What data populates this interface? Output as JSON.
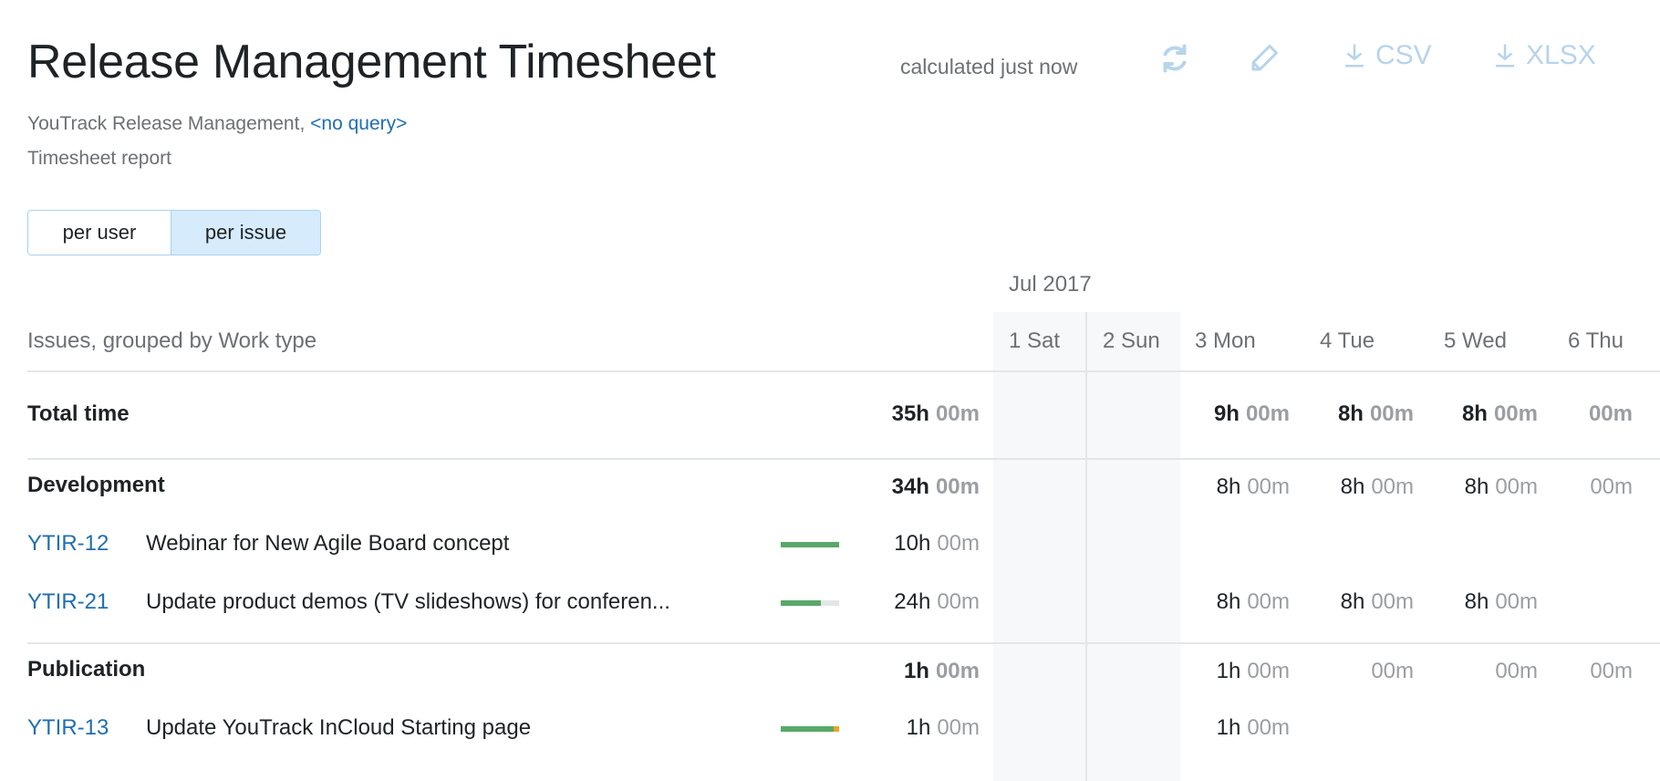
{
  "header": {
    "title": "Release Management Timesheet",
    "calculated": "calculated just now",
    "refresh_icon": "refresh-icon",
    "edit_icon": "pencil-icon",
    "csv_label": "CSV",
    "xlsx_label": "XLSX",
    "download_icon": "download-icon"
  },
  "subtitle": {
    "project": "YouTrack Release Management,",
    "query": "<no query>",
    "report_type": "Timesheet report"
  },
  "toggle": {
    "options": [
      "per user",
      "per issue"
    ],
    "selected": "per issue"
  },
  "table": {
    "grouping_label": "Issues, grouped by Work type",
    "month": "Jul 2017",
    "days": [
      "1 Sat",
      "2 Sun",
      "3 Mon",
      "4 Tue",
      "5 Wed",
      "6 Thu"
    ],
    "weekend_days": [
      "1 Sat",
      "2 Sun"
    ],
    "total": {
      "label": "Total time",
      "sum": {
        "h": "35h",
        "m": "00m"
      },
      "days": [
        null,
        null,
        {
          "h": "9h",
          "m": "00m"
        },
        {
          "h": "8h",
          "m": "00m"
        },
        {
          "h": "8h",
          "m": "00m"
        },
        {
          "h": "",
          "m": "00m"
        }
      ]
    },
    "groups": [
      {
        "name": "Development",
        "sum": {
          "h": "34h",
          "m": "00m"
        },
        "days": [
          null,
          null,
          {
            "h": "8h",
            "m": "00m"
          },
          {
            "h": "8h",
            "m": "00m"
          },
          {
            "h": "8h",
            "m": "00m"
          },
          {
            "h": "",
            "m": "00m"
          }
        ],
        "issues": [
          {
            "id": "YTIR-12",
            "summary": "Webinar for New Agile Board concept",
            "progress_spent": 1.0,
            "progress_over": 0,
            "sum": {
              "h": "10h",
              "m": "00m"
            },
            "days": [
              null,
              null,
              null,
              null,
              null,
              null
            ]
          },
          {
            "id": "YTIR-21",
            "summary": "Update product demos (TV slideshows) for conferen...",
            "progress_spent": 0.69,
            "progress_over": 0,
            "sum": {
              "h": "24h",
              "m": "00m"
            },
            "days": [
              null,
              null,
              {
                "h": "8h",
                "m": "00m"
              },
              {
                "h": "8h",
                "m": "00m"
              },
              {
                "h": "8h",
                "m": "00m"
              },
              null
            ]
          }
        ]
      },
      {
        "name": "Publication",
        "sum": {
          "h": "1h",
          "m": "00m"
        },
        "days": [
          null,
          null,
          {
            "h": "1h",
            "m": "00m"
          },
          {
            "h": "",
            "m": "00m"
          },
          {
            "h": "",
            "m": "00m"
          },
          {
            "h": "",
            "m": "00m"
          }
        ],
        "issues": [
          {
            "id": "YTIR-13",
            "summary": "Update YouTrack InCloud Starting page",
            "progress_spent": 0.91,
            "progress_over": 0.09,
            "sum": {
              "h": "1h",
              "m": "00m"
            },
            "days": [
              null,
              null,
              {
                "h": "1h",
                "m": "00m"
              },
              null,
              null,
              null
            ]
          }
        ]
      }
    ]
  },
  "colors": {
    "accent": "#1f6fb2",
    "progress_ok": "#59a869",
    "progress_over": "#f0a22a",
    "toolbar_disabled": "#b7d4ea",
    "selected_toggle": "#d6ebfc"
  }
}
